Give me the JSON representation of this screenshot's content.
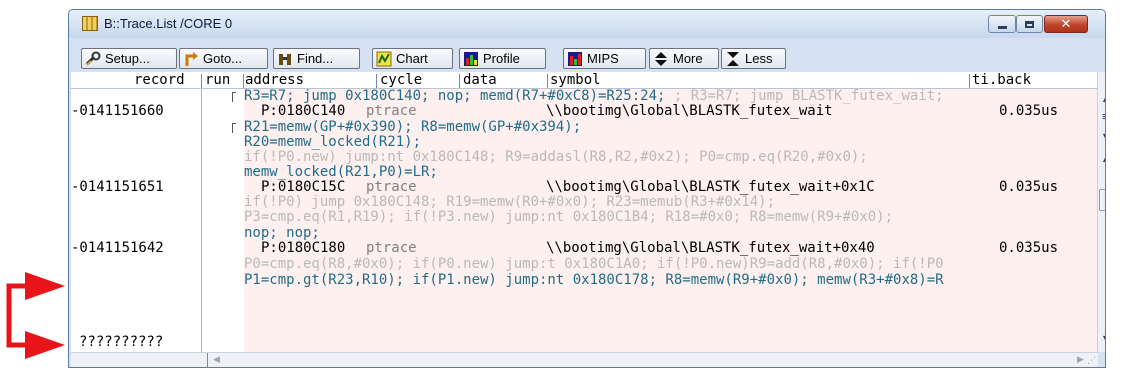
{
  "window": {
    "title": "B::Trace.List /CORE 0"
  },
  "toolbar": {
    "setup": "Setup...",
    "goto": "Goto...",
    "find": "Find...",
    "chart": "Chart",
    "profile": "Profile",
    "mips": "MIPS",
    "more": "More",
    "less": "Less"
  },
  "columns": {
    "record": "record",
    "run": "run",
    "address": "address",
    "cycle": "cycle",
    "data": "data",
    "symbol": "symbol",
    "tiback": "ti.back"
  },
  "rows": {
    "l1": "R3=R7; jump 0x180C140; nop; memd(R7+#0xC8)=R25:24;",
    "l1b": " ; R3=R7; jump BLASTK_futex_wait;",
    "r1_rec": "-0141151660",
    "r1_addr": "P:0180C140",
    "r1_cycle": "ptrace",
    "r1_sym": "\\\\bootimg\\Global\\BLASTK_futex_wait",
    "r1_time": "0.035us",
    "l3": "R21=memw(GP+#0x390); R8=memw(GP+#0x394);",
    "l4": "R20=memw_locked(R21);",
    "l5": "if(!P0.new) jump:nt 0x180C148; R9=addasl(R8,R2,#0x2); P0=cmp.eq(R20,#0x0);",
    "l6": "memw_locked(R21,P0)=LR;",
    "r2_rec": "-0141151651",
    "r2_addr": "P:0180C15C",
    "r2_cycle": "ptrace",
    "r2_sym": "\\\\bootimg\\Global\\BLASTK_futex_wait+0x1C",
    "r2_time": "0.035us",
    "l8": "if(!P0) jump 0x180C148; R19=memw(R0+#0x0); R23=memub(R3+#0x14);",
    "l9": "P3=cmp.eq(R1,R19); if(!P3.new) jump:nt 0x180C1B4; R18=#0x0; R8=memw(R9+#0x0);",
    "l10": "nop; nop;",
    "r3_rec": "-0141151642",
    "r3_addr": "P:0180C180",
    "r3_cycle": "ptrace",
    "r3_sym": "\\\\bootimg\\Global\\BLASTK_futex_wait+0x40",
    "r3_time": "0.035us",
    "l12": "P0=cmp.eq(R8,#0x0); if(P0.new) jump:t 0x180C1A0; if(!P0.new)R9=add(R8,#0x0); if(!P0",
    "l13": "P1=cmp.gt(R23,R10); if(P1.new) jump:nt 0x180C178; R8=memw(R9+#0x0); memw(R3+#0x8)=R",
    "r4_rec": "??????????"
  },
  "colors": {
    "arrow": "#e8141a",
    "row_background": "#fff0f0",
    "code_text": "#1f6d87",
    "dim_text": "#b9b9b9"
  }
}
